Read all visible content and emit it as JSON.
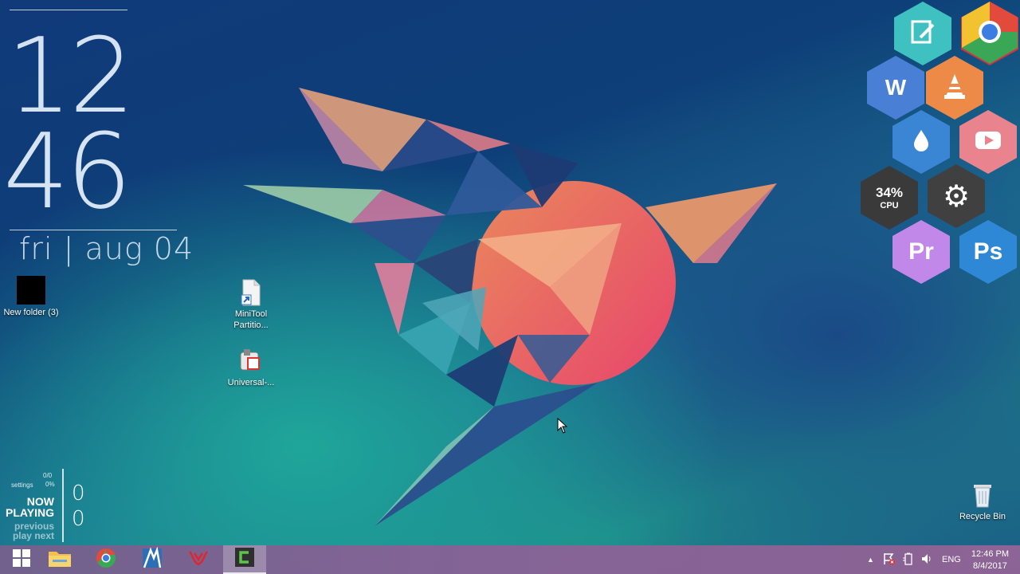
{
  "clock": {
    "hour": "12",
    "minute": "46",
    "date": "fri | aug 04"
  },
  "desktop_icons": [
    {
      "label": "New folder (3)"
    },
    {
      "label": "MiniTool Partitio..."
    },
    {
      "label": "Universal-..."
    },
    {
      "label": "Recycle Bin"
    }
  ],
  "hex_launcher": {
    "word_letter": "W",
    "cpu_percent": "34%",
    "cpu_label": "CPU",
    "premiere_letters": "Pr",
    "photoshop_letters": "Ps"
  },
  "now_playing": {
    "counter_top": "0/0",
    "settings_label": "settings",
    "percent": "0%",
    "now": "NOW",
    "playing": "PLAYING",
    "previous": "previous",
    "play_next": "play next",
    "count_1": "0",
    "count_2": "0"
  },
  "taskbar": {
    "language": "ENG",
    "time": "12:46 PM",
    "date": "8/4/2017"
  },
  "colors": {
    "accent_orange": "#f0684f",
    "taskbar": "#8a5f94"
  }
}
